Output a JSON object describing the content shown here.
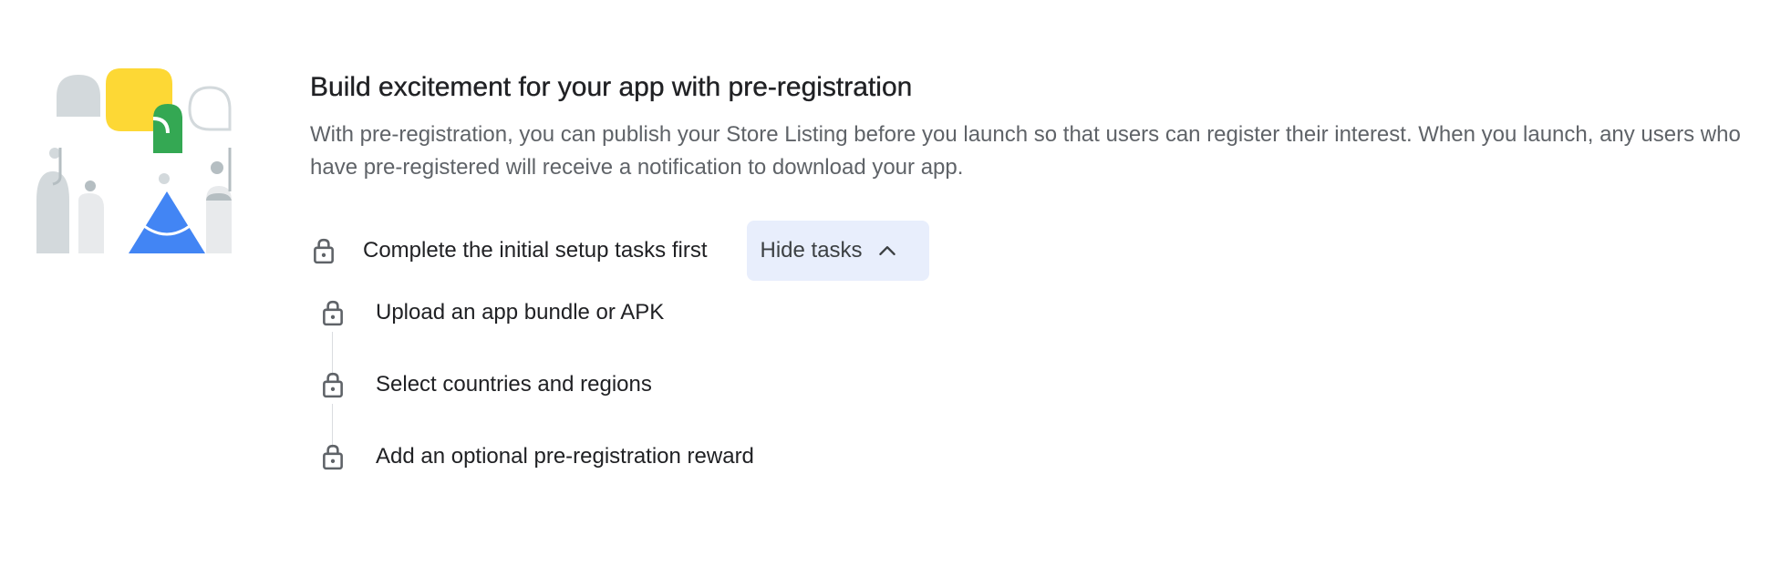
{
  "header": {
    "title": "Build excitement for your app with pre-registration",
    "description": "With pre-registration, you can publish your Store Listing before you launch so that users can register their interest. When you launch, any users who have pre-registered will receive a notification to download your app."
  },
  "setup": {
    "label": "Complete the initial setup tasks first",
    "lock_icon": "lock-icon",
    "toggle_button": {
      "label": "Hide tasks",
      "icon": "chevron-up-icon"
    }
  },
  "tasks": [
    {
      "label": "Upload an app bundle or APK",
      "icon": "lock-icon"
    },
    {
      "label": "Select countries and regions",
      "icon": "lock-icon"
    },
    {
      "label": "Add an optional pre-registration reward",
      "icon": "lock-icon"
    }
  ],
  "colors": {
    "button_bg": "#e8eefc",
    "text_primary": "#202124",
    "text_secondary": "#5f6368",
    "illustration_yellow": "#fdd835",
    "illustration_green": "#34a853",
    "illustration_blue": "#4285f4",
    "illustration_grey": "#d3d9dc"
  }
}
